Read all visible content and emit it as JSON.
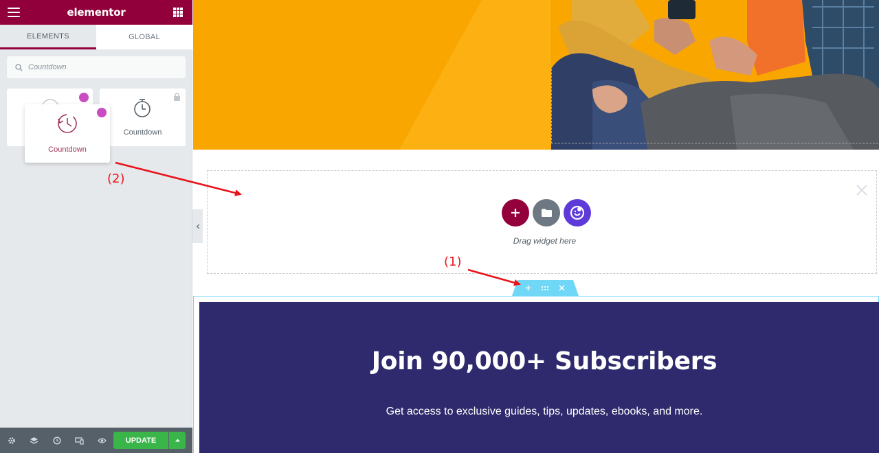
{
  "sidebar": {
    "brand": "elementor",
    "tabs": [
      {
        "label": "ELEMENTS"
      },
      {
        "label": "GLOBAL"
      }
    ],
    "search": {
      "value": "Countdown"
    },
    "widgets": [
      {
        "label": "Countdown",
        "icon": "countdown-clock-icon",
        "badge": "ea-pro-badge"
      },
      {
        "label": "Countdown",
        "icon": "stopwatch-icon",
        "badge": "lock-icon"
      }
    ],
    "drag_ghost": {
      "label": "Countdown"
    },
    "footer": {
      "icons": [
        "settings-icon",
        "layers-icon",
        "history-icon",
        "responsive-icon",
        "preview-icon"
      ],
      "update_label": "UPDATE"
    }
  },
  "canvas": {
    "drop_zone": {
      "text": "Drag widget here"
    },
    "subscribe": {
      "title": "Join 90,000+ Subscribers",
      "text": "Get access to exclusive guides, tips, updates, ebooks, and more."
    }
  },
  "annotations": {
    "one": "(1)",
    "two": "(2)",
    "color": "#e8141b"
  },
  "colors": {
    "brand": "#92003b",
    "hero": "#f9a600",
    "update": "#39b54a",
    "section_bg": "#2e2a6d",
    "section_border": "#71d7f7"
  }
}
